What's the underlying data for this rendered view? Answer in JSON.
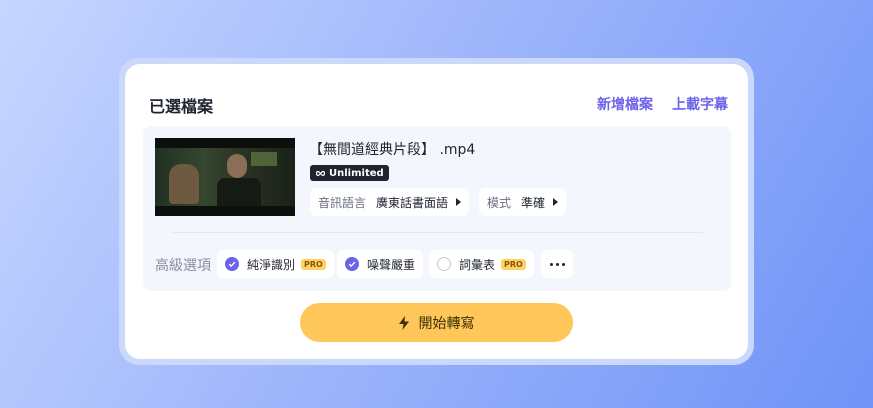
{
  "header": {
    "title": "已選檔案",
    "add_file_label": "新增檔案",
    "upload_subtitle_label": "上載字幕"
  },
  "file": {
    "name": "【無間道經典片段】 .mp4",
    "badge": "Unlimited",
    "language_label": "音訊語言",
    "language_value": "廣東話書面語",
    "mode_label": "模式",
    "mode_value": "準確"
  },
  "advanced": {
    "label": "高級選項",
    "options": [
      {
        "label": "純淨識別",
        "checked": true,
        "pro": "PRO"
      },
      {
        "label": "噪聲嚴重",
        "checked": true,
        "pro": ""
      },
      {
        "label": "詞彙表",
        "checked": false,
        "pro": "PRO"
      }
    ]
  },
  "start_button": {
    "label": "開始轉寫",
    "icon": "lightning-icon"
  },
  "colors": {
    "accent": "#6c63e8",
    "button": "#ffc75a",
    "pro_badge": "#ffd166"
  }
}
